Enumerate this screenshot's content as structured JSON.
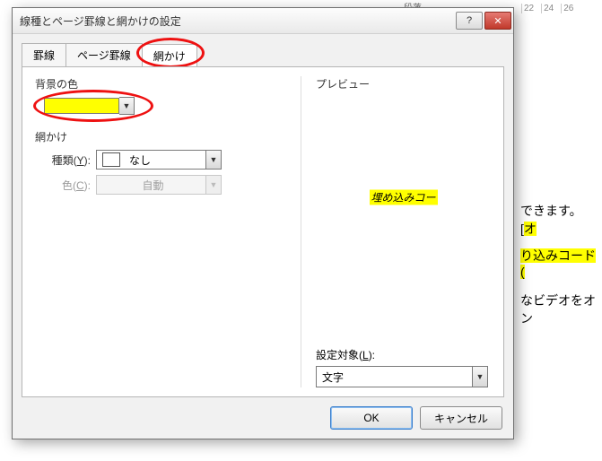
{
  "ribbon_label": "段落",
  "ruler_marks": [
    "22",
    "24",
    "26"
  ],
  "doc": {
    "line1_a": "できます。[",
    "line1_b": "オ",
    "line2": "り込みコード(",
    "line3": "なビデオをオン"
  },
  "dialog": {
    "title": "線種とページ罫線と網かけの設定",
    "help_glyph": "?",
    "close_glyph": "✕",
    "tabs": {
      "tab1": "罫線",
      "tab2": "ページ罫線",
      "tab3": "網かけ"
    },
    "left": {
      "bgcolor_label": "背景の色",
      "bgcolor_value": "#ffff00",
      "shade_label": "網かけ",
      "type_label": "種類(",
      "type_key": "Y",
      "type_suffix": "):",
      "type_value": "なし",
      "color_label": "色(",
      "color_key": "C",
      "color_suffix": "):",
      "color_value": "自動"
    },
    "right": {
      "preview_label": "プレビュー",
      "preview_sample": "埋め込みコー",
      "apply_label": "設定対象(",
      "apply_key": "L",
      "apply_suffix": "):",
      "apply_value": "文字"
    },
    "buttons": {
      "ok": "OK",
      "cancel": "キャンセル"
    },
    "drop_glyph": "▼"
  }
}
